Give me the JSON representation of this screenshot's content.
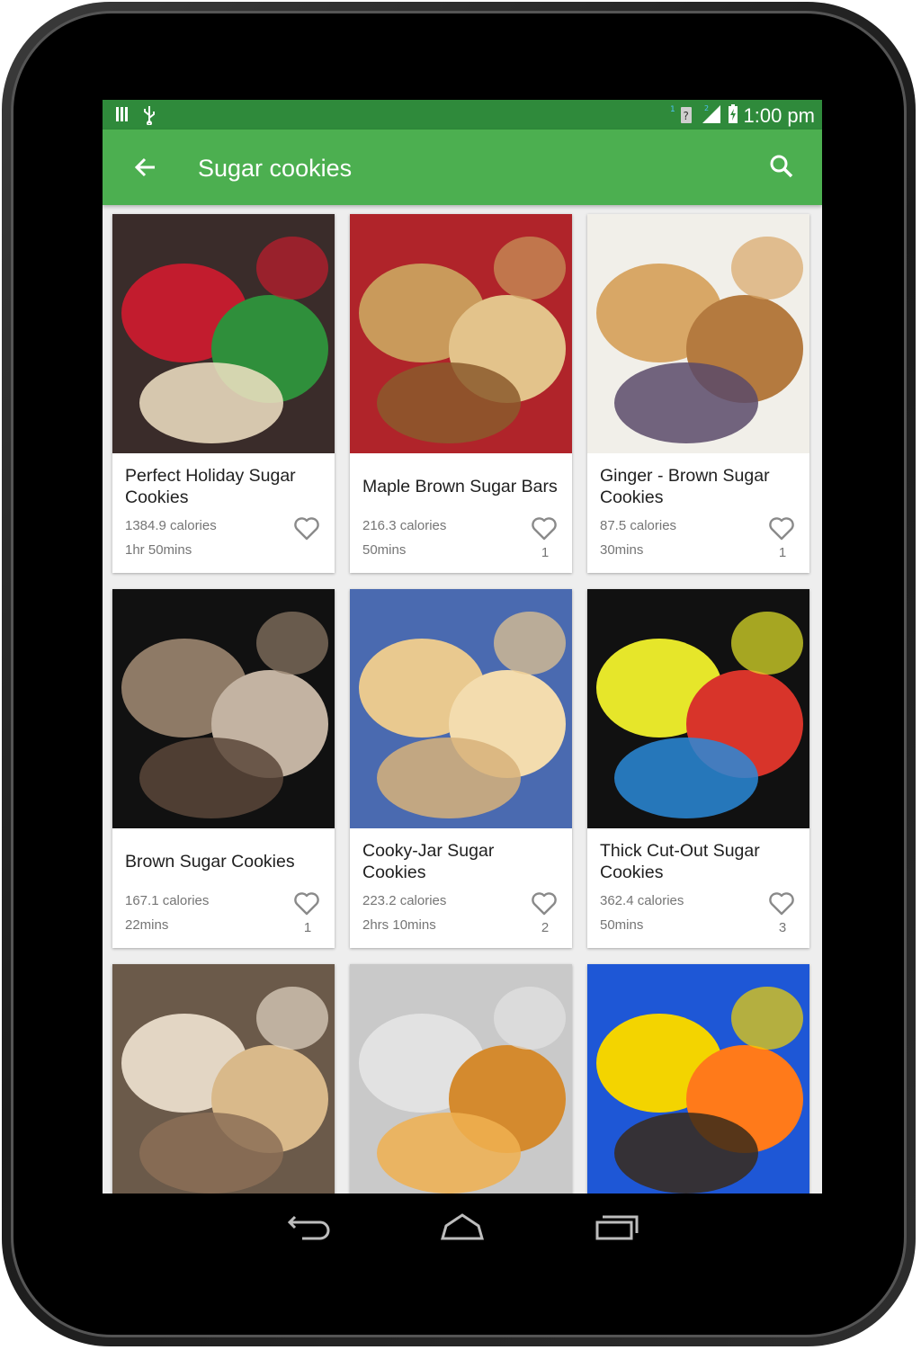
{
  "status_bar": {
    "time": "1:00 pm",
    "icons": [
      "sd-card-icon",
      "usb-icon",
      "sim-1-icon",
      "signal-icon",
      "battery-charging-icon"
    ]
  },
  "app_bar": {
    "title": "Sugar cookies",
    "back_icon": "arrow-back-icon",
    "search_icon": "search-icon"
  },
  "recipes": [
    {
      "name": "Perfect Holiday Sugar Cookies",
      "calories": "1384.9 calories",
      "time": "1hr 50mins",
      "likes": "",
      "image": "holiday-cookies-photo",
      "palette": [
        "#3a2c2a",
        "#c21c2e",
        "#2f8f3b",
        "#f2e3c6"
      ]
    },
    {
      "name": "Maple Brown Sugar Bars",
      "calories": "216.3 calories",
      "time": "50mins",
      "likes": "1",
      "image": "brown-sugar-bars-photo",
      "palette": [
        "#b0242a",
        "#c99a5b",
        "#e3c38b",
        "#8b5a2b"
      ]
    },
    {
      "name": "Ginger - Brown Sugar Cookies",
      "calories": "87.5 calories",
      "time": "30mins",
      "likes": "1",
      "image": "dipped-cookies-photo",
      "palette": [
        "#f1efe9",
        "#d8a766",
        "#b47a3f",
        "#5a4a6a"
      ]
    },
    {
      "name": "Brown Sugar Cookies",
      "calories": "167.1 calories",
      "time": "22mins",
      "likes": "1",
      "image": "oatmeal-cookies-photo",
      "palette": [
        "#111111",
        "#8e7a66",
        "#c3b3a2",
        "#5a463a"
      ]
    },
    {
      "name": "Cooky-Jar Sugar Cookies",
      "calories": "223.2 calories",
      "time": "2hrs 10mins",
      "likes": "2",
      "image": "crinkle-cookies-photo",
      "palette": [
        "#4a6ab0",
        "#e9c98f",
        "#f3dcae",
        "#d7b27a"
      ]
    },
    {
      "name": "Thick Cut-Out Sugar Cookies",
      "calories": "362.4 calories",
      "time": "50mins",
      "likes": "3",
      "image": "decorated-cookies-photo",
      "palette": [
        "#111111",
        "#e6e62a",
        "#d8342a",
        "#2a8ad8"
      ]
    },
    {
      "name": "",
      "calories": "",
      "time": "",
      "likes": "",
      "image": "cross-cookies-photo",
      "palette": [
        "#6b5a4a",
        "#e3d6c4",
        "#d9b98a",
        "#8b6f56"
      ]
    },
    {
      "name": "",
      "calories": "",
      "time": "",
      "likes": "",
      "image": "snickerdoodles-photo",
      "palette": [
        "#c9c9c9",
        "#e2e2e2",
        "#d48a2e",
        "#f0b050"
      ]
    },
    {
      "name": "",
      "calories": "",
      "time": "",
      "likes": "",
      "image": "candy-corn-cookie-photo",
      "palette": [
        "#1e57d6",
        "#f3d400",
        "#ff7a1a",
        "#3a2a1a"
      ]
    }
  ],
  "nav_bar": {
    "back": "nav-back-icon",
    "home": "nav-home-icon",
    "recents": "nav-recents-icon"
  }
}
